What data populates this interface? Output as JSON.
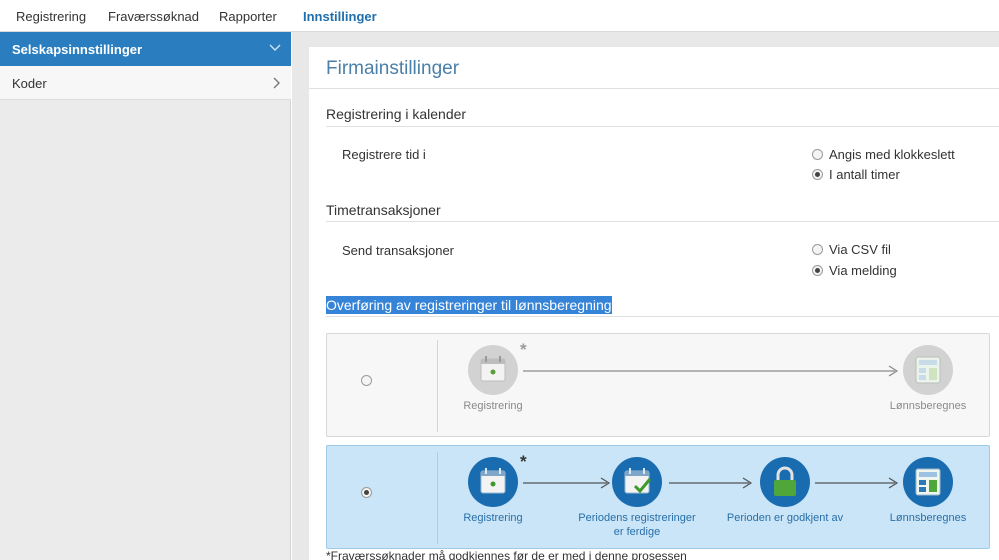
{
  "topnav": {
    "tabs": [
      {
        "label": "Registrering",
        "active": false
      },
      {
        "label": "Fraværssøknad",
        "active": false
      },
      {
        "label": "Rapporter",
        "active": false
      },
      {
        "label": "Innstillinger",
        "active": true
      }
    ]
  },
  "sidebar": {
    "items": [
      {
        "label": "Selskapsinnstillinger",
        "icon": "chevron-down-icon",
        "active": true
      },
      {
        "label": "Koder",
        "icon": "chevron-right-icon",
        "active": false
      }
    ]
  },
  "page": {
    "title": "Firmainstillinger",
    "sections": {
      "calendar": {
        "title": "Registrering i kalender",
        "field_label": "Registrere tid i",
        "options": [
          {
            "label": "Angis med klokkeslett",
            "checked": false
          },
          {
            "label": "I antall timer",
            "checked": true
          }
        ]
      },
      "transactions": {
        "title": "Timetransaksjoner",
        "field_label": "Send transaksjoner",
        "options": [
          {
            "label": "Via CSV fil",
            "checked": false
          },
          {
            "label": "Via melding",
            "checked": true
          }
        ]
      },
      "transfer": {
        "title": "Overføring av registreringer til lønnsberegning",
        "flows": [
          {
            "selected": false,
            "steps": [
              "Registrering",
              "Lønnsberegnes"
            ],
            "star": "*"
          },
          {
            "selected": true,
            "steps": [
              "Registrering",
              "Periodens registreringer er ferdige",
              "Perioden er godkjent av",
              "Lønnsberegnes"
            ],
            "star": "*"
          }
        ],
        "footnote": "*Fraværssøknader må godkjennes før de er med i denne prosessen"
      }
    }
  },
  "colors": {
    "accent": "#2a7ec0",
    "highlight": "#3584d8",
    "selected_flow": "#c9e5f7",
    "step_active": "#1a6cb0",
    "step_inactive": "#cfcfcf"
  }
}
